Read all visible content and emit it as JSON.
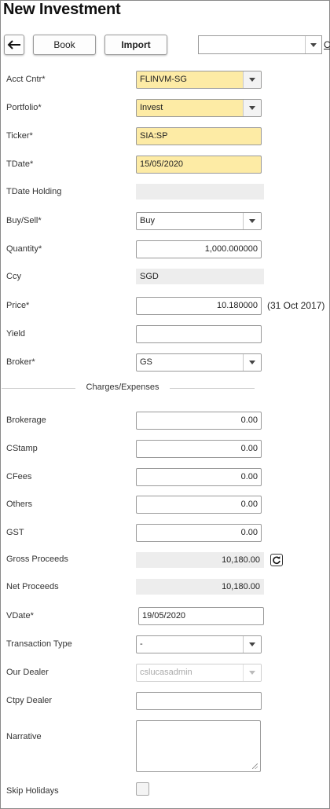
{
  "header": {
    "title": "New Investment"
  },
  "toolbar": {
    "book_label": "Book",
    "import_label": "Import",
    "top_select_value": "",
    "cut_link_text": "C"
  },
  "form": {
    "acct_cntr": {
      "label": "Acct Cntr*",
      "value": "FLINVM-SG"
    },
    "portfolio": {
      "label": "Portfolio*",
      "value": "Invest"
    },
    "ticker": {
      "label": "Ticker*",
      "value": "SIA:SP"
    },
    "tdate": {
      "label": "TDate*",
      "value": "15/05/2020"
    },
    "tdate_holding": {
      "label": "TDate Holding",
      "value": ""
    },
    "buy_sell": {
      "label": "Buy/Sell*",
      "value": "Buy"
    },
    "quantity": {
      "label": "Quantity*",
      "value": "1,000.000000"
    },
    "ccy": {
      "label": "Ccy",
      "value": "SGD"
    },
    "price": {
      "label": "Price*",
      "value": "10.180000",
      "note": "(31 Oct 2017)"
    },
    "yield": {
      "label": "Yield",
      "value": ""
    },
    "broker": {
      "label": "Broker*",
      "value": "GS"
    }
  },
  "charges": {
    "section_title": "Charges/Expenses",
    "brokerage": {
      "label": "Brokerage",
      "value": "0.00"
    },
    "cstamp": {
      "label": "CStamp",
      "value": "0.00"
    },
    "cfees": {
      "label": "CFees",
      "value": "0.00"
    },
    "others": {
      "label": "Others",
      "value": "0.00"
    },
    "gst": {
      "label": "GST",
      "value": "0.00"
    },
    "gross_proceeds": {
      "label": "Gross Proceeds",
      "value": "10,180.00"
    },
    "net_proceeds": {
      "label": "Net Proceeds",
      "value": "10,180.00"
    },
    "vdate": {
      "label": "VDate*",
      "value": "19/05/2020"
    },
    "transaction_type": {
      "label": "Transaction Type",
      "value": "-"
    },
    "our_dealer": {
      "label": "Our Dealer",
      "value": "cslucasadmin"
    },
    "ctpy_dealer": {
      "label": "Ctpy Dealer",
      "value": ""
    },
    "narrative": {
      "label": "Narrative",
      "value": ""
    },
    "skip_holidays": {
      "label": "Skip Holidays",
      "checked": false
    }
  },
  "colors": {
    "required_field": "#fdeba5",
    "readonly_field": "#ededed",
    "border": "#9a9a9a"
  },
  "icons": {
    "back": "arrow-left-icon",
    "dropdown": "chevron-down-icon",
    "refresh": "refresh-icon"
  }
}
